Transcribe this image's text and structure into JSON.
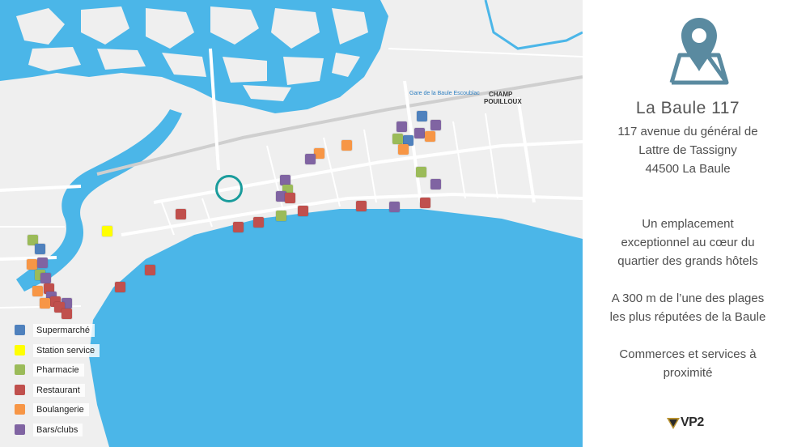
{
  "colors": {
    "supermarche": "#4f81bd",
    "station": "#ffff00",
    "pharmacie": "#9bbb59",
    "restaurant": "#c0504d",
    "boulangerie": "#f79646",
    "bars": "#8064a2",
    "sea": "#4bb6e8",
    "land": "#efefef",
    "accent": "#1a9c9c",
    "pin": "#5a8aa0"
  },
  "legend": [
    {
      "label": "Supermarché",
      "key": "supermarche"
    },
    {
      "label": "Station service",
      "key": "station"
    },
    {
      "label": "Pharmacie",
      "key": "pharmacie"
    },
    {
      "label": "Restaurant",
      "key": "restaurant"
    },
    {
      "label": "Boulangerie",
      "key": "boulangerie"
    },
    {
      "label": "Bars/clubs",
      "key": "bars"
    }
  ],
  "map_labels": {
    "station": "Gare de la Baule Escoublac",
    "district_line1": "CHAMP",
    "district_line2": "POUILLOUX"
  },
  "panel": {
    "icon": "location-pin-map-icon",
    "title": "La Baule 117",
    "address": [
      "117 avenue du général de",
      "Lattre de Tassigny",
      "44500 La Baule"
    ],
    "description": [
      "Un emplacement",
      "exceptionnel au cœur du",
      "quartier des grands hôtels",
      "A 300 m de l’une des plages",
      "les plus réputées de la Baule",
      "Commerces et services à",
      "proximité"
    ],
    "logo_text": "VP2"
  }
}
